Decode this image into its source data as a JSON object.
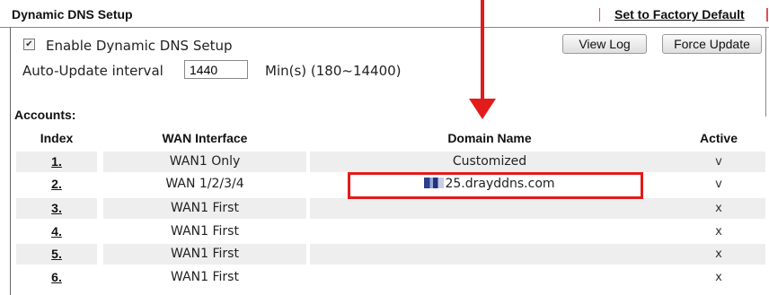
{
  "header": {
    "title": "Dynamic DNS Setup",
    "factory_default_link": "Set to Factory Default"
  },
  "settings": {
    "enable_label": "Enable Dynamic DNS Setup",
    "enable_checked": true,
    "auto_update_label": "Auto-Update interval",
    "interval_value": "1440",
    "interval_unit_hint": "Min(s) (180~14400)"
  },
  "buttons": {
    "view_log": "View Log",
    "force_update": "Force Update"
  },
  "accounts": {
    "title": "Accounts:",
    "columns": [
      "Index",
      "WAN Interface",
      "Domain Name",
      "Active"
    ],
    "rows": [
      {
        "index": "1.",
        "wan": "WAN1 Only",
        "domain": "Customized",
        "active": "v"
      },
      {
        "index": "2.",
        "wan": "WAN 1/2/3/4",
        "domain": "25.drayddns.com",
        "active": "v"
      },
      {
        "index": "3.",
        "wan": "WAN1 First",
        "domain": "",
        "active": "x"
      },
      {
        "index": "4.",
        "wan": "WAN1 First",
        "domain": "",
        "active": "x"
      },
      {
        "index": "5.",
        "wan": "WAN1 First",
        "domain": "",
        "active": "x"
      },
      {
        "index": "6.",
        "wan": "WAN1 First",
        "domain": "",
        "active": "x"
      }
    ]
  },
  "annotation": {
    "color": "#e21b1b"
  }
}
